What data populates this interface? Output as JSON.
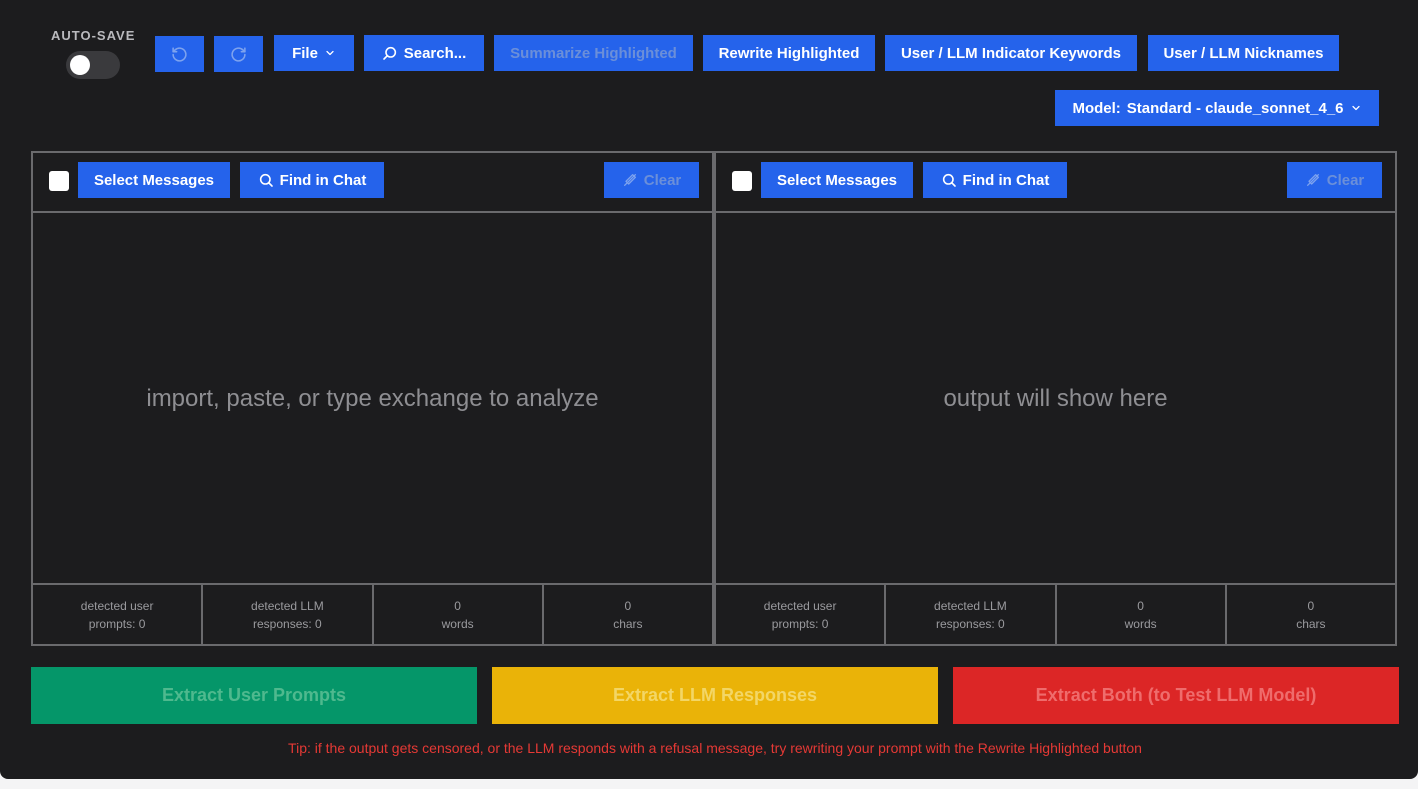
{
  "toolbar": {
    "autosave_label": "AUTO-SAVE",
    "autosave_on": false,
    "undo_icon": "undo-icon",
    "redo_icon": "redo-icon",
    "file_label": "File",
    "search_label": "Search...",
    "summarize_label": "Summarize Highlighted",
    "rewrite_label": "Rewrite Highlighted",
    "indicator_label": "User / LLM Indicator Keywords",
    "nicknames_label": "User / LLM Nicknames",
    "model_label": "Model:",
    "model_value": "Standard - claude_sonnet_4_6"
  },
  "left_panel": {
    "select_label": "Select Messages",
    "find_label": "Find in Chat",
    "clear_label": "Clear",
    "placeholder": "import, paste, or type exchange to analyze",
    "stats": {
      "user_prompts_line1": "detected user",
      "user_prompts_line2": "prompts: 0",
      "llm_responses_line1": "detected LLM",
      "llm_responses_line2": "responses: 0",
      "words_value": "0",
      "words_label": "words",
      "chars_value": "0",
      "chars_label": "chars"
    }
  },
  "right_panel": {
    "select_label": "Select Messages",
    "find_label": "Find in Chat",
    "clear_label": "Clear",
    "placeholder": "output will show here",
    "stats": {
      "user_prompts_line1": "detected user",
      "user_prompts_line2": "prompts: 0",
      "llm_responses_line1": "detected LLM",
      "llm_responses_line2": "responses: 0",
      "words_value": "0",
      "words_label": "words",
      "chars_value": "0",
      "chars_label": "chars"
    }
  },
  "actions": {
    "extract_user": "Extract User Prompts",
    "extract_llm": "Extract LLM Responses",
    "extract_both": "Extract Both (to Test LLM Model)"
  },
  "colors": {
    "primary": "#2563eb",
    "extract_user_bg": "#059669",
    "extract_user_fg": "#4fb98e",
    "extract_llm_bg": "#eab308",
    "extract_llm_fg": "#f3d666",
    "extract_both_bg": "#dc2626",
    "extract_both_fg": "#ef6c6c",
    "tip": "#e53935"
  },
  "tip": "Tip: if the output gets censored, or the LLM responds with a refusal message, try rewriting your prompt with the Rewrite Highlighted button"
}
